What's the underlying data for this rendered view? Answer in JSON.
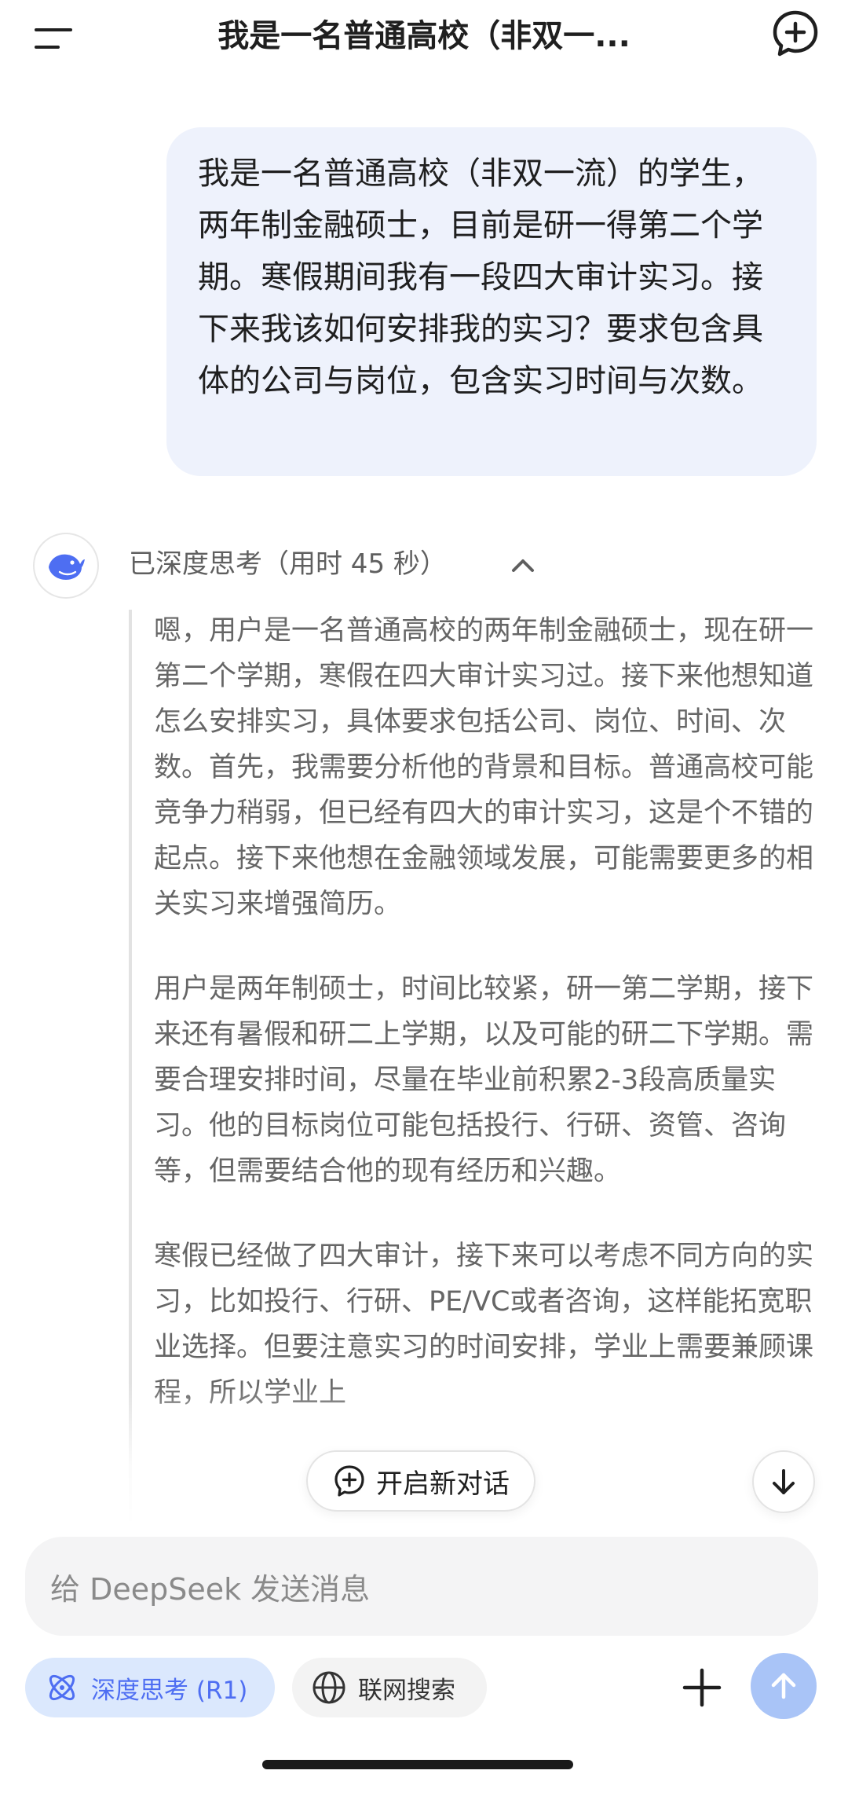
{
  "header": {
    "title": "我是一名普通高校（非双一...",
    "menu_icon": "menu-icon",
    "new_chat_icon": "new-chat-plus-icon"
  },
  "user_message": {
    "text": "我是一名普通高校（非双一流）的学生，两年制金融硕士，目前是研一得第二个学期。寒假期间我有一段四大审计实习。接下来我该如何安排我的实习？要求包含具体的公司与岗位，包含实习时间与次数。"
  },
  "assistant": {
    "avatar_icon": "deepseek-whale-icon",
    "thinking_label": "已深度思考（用时 45 秒）",
    "paragraphs": [
      "嗯，用户是一名普通高校的两年制金融硕士，现在研一第二个学期，寒假在四大审计实习过。接下来他想知道怎么安排实习，具体要求包括公司、岗位、时间、次数。首先，我需要分析他的背景和目标。普通高校可能竞争力稍弱，但已经有四大的审计实习，这是个不错的起点。接下来他想在金融领域发展，可能需要更多的相关实习来增强简历。",
      "用户是两年制硕士，时间比较紧，研一第二学期，接下来还有暑假和研二上学期，以及可能的研二下学期。需要合理安排时间，尽量在毕业前积累2-3段高质量实习。他的目标岗位可能包括投行、行研、资管、咨询等，但需要结合他的现有经历和兴趣。",
      "寒假已经做了四大审计，接下来可以考虑不同方向的实习，比如投行、行研、PE/VC或者咨询，这样能拓宽职业选择。但要注意实习的时间安排，学业上需要兼顾课程，所以学业上"
    ]
  },
  "floating": {
    "new_chat_label": "开启新对话",
    "scroll_down_icon": "arrow-down-icon"
  },
  "composer": {
    "placeholder": "给 DeepSeek 发送消息",
    "deep_think_label": "深度思考 (R1)",
    "web_search_label": "联网搜索"
  },
  "colors": {
    "accent": "#4e6ef2",
    "user_bubble": "#eef2fc",
    "send_button": "#a9c4f7"
  }
}
